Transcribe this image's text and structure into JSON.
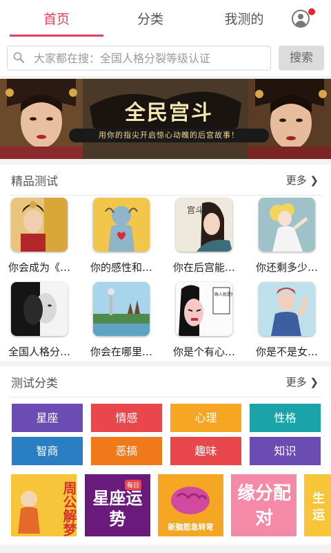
{
  "tabs": [
    {
      "label": "首页",
      "active": true
    },
    {
      "label": "分类",
      "active": false
    },
    {
      "label": "我测的",
      "active": false
    }
  ],
  "colors": {
    "accent": "#e0405a",
    "notify": "#e8232f"
  },
  "search": {
    "placeholder": "大家都在搜：全国人格分裂等级认证",
    "button_label": "搜索",
    "icon": "search-icon"
  },
  "banner": {
    "title": "全民宫斗",
    "subtitle": "用你的指尖开启惊心动魄的后宫故事！",
    "slide_count": 5,
    "active_slide": 1
  },
  "featured": {
    "title": "精品测试",
    "more_label": "更多",
    "items": [
      {
        "caption": "你会成为《…"
      },
      {
        "caption": "你的感性和…"
      },
      {
        "caption": "你在后宫能…"
      },
      {
        "caption": "你还剩多少…"
      },
      {
        "caption": "全国人格分…"
      },
      {
        "caption": "你会在哪里…"
      },
      {
        "caption": "你是个有心…"
      },
      {
        "caption": "你是不是女…"
      }
    ],
    "thumb_text": {
      "item_3": "宫斗",
      "item_7": "贱人就是矫情"
    }
  },
  "categories": {
    "title": "测试分类",
    "more_label": "更多",
    "items": [
      {
        "label": "星座",
        "color": "#6a4cb2"
      },
      {
        "label": "情感",
        "color": "#e8474c"
      },
      {
        "label": "心理",
        "color": "#f5a623"
      },
      {
        "label": "性格",
        "color": "#1aa3a8"
      },
      {
        "label": "智商",
        "color": "#2a7fc2"
      },
      {
        "label": "恶搞",
        "color": "#f07a1a"
      },
      {
        "label": "趣味",
        "color": "#e8474c"
      },
      {
        "label": "知识",
        "color": "#6a4cb2"
      }
    ]
  },
  "promos": [
    {
      "text": "周公解梦"
    },
    {
      "text": "星座运势",
      "tag": "每日"
    },
    {
      "text": "新脑筋急转弯"
    },
    {
      "text": "缘分配对"
    },
    {
      "text": "生运"
    }
  ]
}
